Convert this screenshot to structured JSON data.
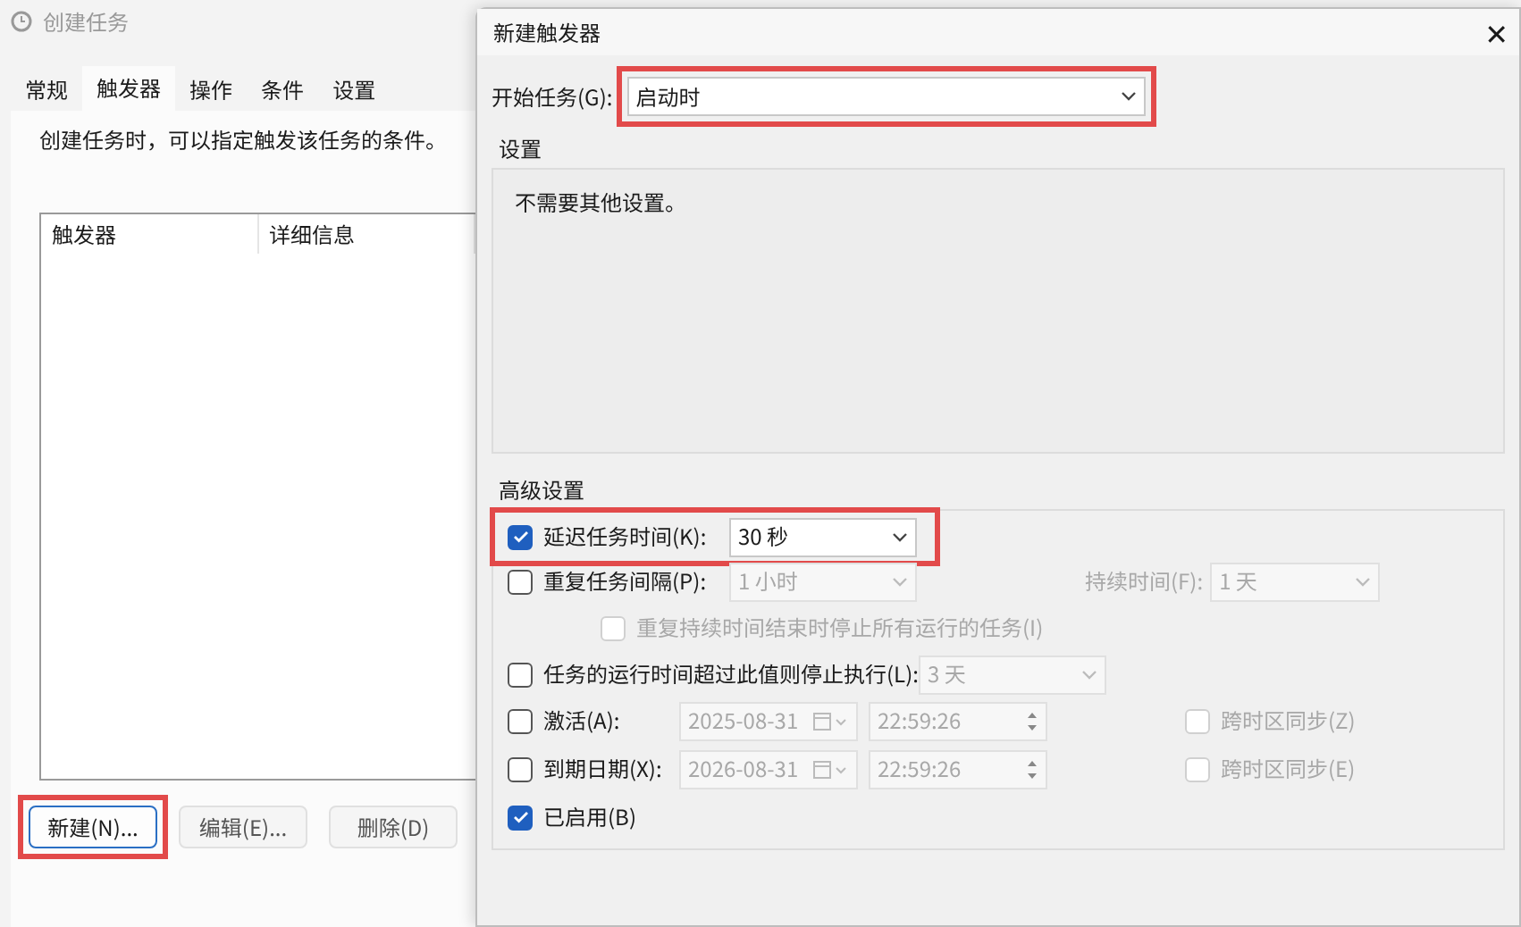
{
  "background_window": {
    "title": "创建任务",
    "tabs": [
      {
        "label": "常规",
        "selected": false
      },
      {
        "label": "触发器",
        "selected": true
      },
      {
        "label": "操作",
        "selected": false
      },
      {
        "label": "条件",
        "selected": false
      },
      {
        "label": "设置",
        "selected": false
      }
    ],
    "description": "创建任务时，可以指定触发该任务的条件。",
    "trigger_list": {
      "columns": [
        "触发器",
        "详细信息"
      ]
    },
    "buttons": [
      {
        "label": "新建(N)...",
        "disabled": false,
        "focused": true,
        "highlighted": true
      },
      {
        "label": "编辑(E)...",
        "disabled": true,
        "focused": false,
        "highlighted": false
      },
      {
        "label": "删除(D)",
        "disabled": true,
        "focused": false,
        "highlighted": false
      }
    ]
  },
  "dialog": {
    "title": "新建触发器",
    "close": "✕",
    "start_task": {
      "label": "开始任务(G):",
      "value": "启动时",
      "highlighted": true
    },
    "settings_group": {
      "title": "设置",
      "text": "不需要其他设置。"
    },
    "advanced": {
      "title": "高级设置",
      "rows": [
        {
          "kind": "combo",
          "label": "延迟任务时间(K):",
          "checked": true,
          "value": "30 秒",
          "disabled": false,
          "highlighted": true
        },
        {
          "kind": "combo",
          "label": "重复任务间隔(P):",
          "checked": false,
          "value": "1 小时",
          "disabled": true,
          "highlighted": false,
          "side_label": "持续时间(F):",
          "side_value": "1 天"
        },
        {
          "kind": "sub_checkbox",
          "label": "重复持续时间结束时停止所有运行的任务(I)",
          "checked": false,
          "disabled": true
        },
        {
          "kind": "combo",
          "label": "任务的运行时间超过此值则停止执行(L):",
          "checked": false,
          "value": "3 天",
          "disabled": true,
          "highlighted": false
        },
        {
          "kind": "datetime",
          "label": "激活(A):",
          "checked": false,
          "date": "2025-08-31",
          "time": "22:59:26",
          "disabled": true,
          "sync_label": "跨时区同步(Z)",
          "sync_checked": false
        },
        {
          "kind": "datetime",
          "label": "到期日期(X):",
          "checked": false,
          "date": "2026-08-31",
          "time": "22:59:26",
          "disabled": true,
          "sync_label": "跨时区同步(E)",
          "sync_checked": false
        },
        {
          "kind": "checkbox",
          "label": "已启用(B)",
          "checked": true,
          "disabled": false
        }
      ]
    }
  }
}
